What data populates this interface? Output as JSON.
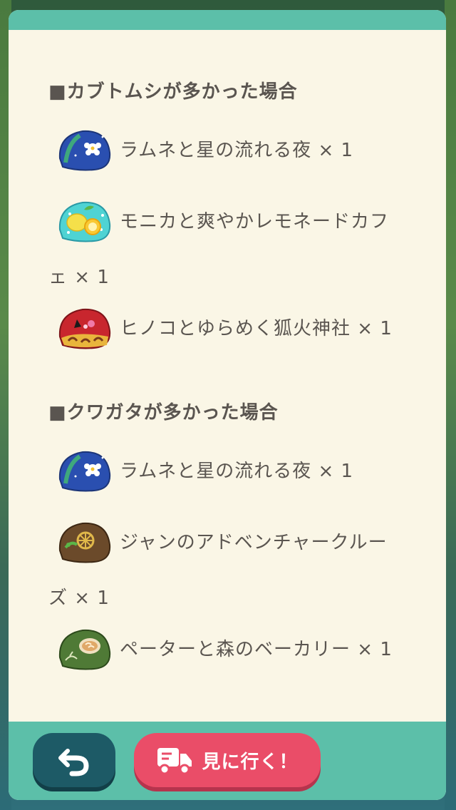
{
  "sections": [
    {
      "title": "■カブトムシが多かった場合",
      "items": [
        {
          "name": "ラムネと星の流れる夜 × 1",
          "icon": "cookie-starry-night-icon"
        },
        {
          "name": "モニカと爽やかレモネードカフ",
          "cont": "ェ × 1",
          "icon": "cookie-lemonade-icon"
        },
        {
          "name": "ヒノコとゆらめく狐火神社 × 1",
          "icon": "cookie-fox-shrine-icon"
        }
      ]
    },
    {
      "title": "■クワガタが多かった場合",
      "items": [
        {
          "name": "ラムネと星の流れる夜 × 1",
          "icon": "cookie-starry-night-icon"
        },
        {
          "name": "ジャンのアドベンチャークルー",
          "cont": "ズ × 1",
          "icon": "cookie-adventure-icon"
        },
        {
          "name": "ペーターと森のベーカリー × 1",
          "icon": "cookie-bakery-icon"
        }
      ]
    }
  ],
  "footer": {
    "go_label": "見に行く！"
  },
  "colors": {
    "panel_bg": "#faf6e6",
    "teal": "#5cbfa9",
    "back_button": "#1d5a66",
    "go_button": "#ea4d68",
    "text": "#5a5550"
  }
}
